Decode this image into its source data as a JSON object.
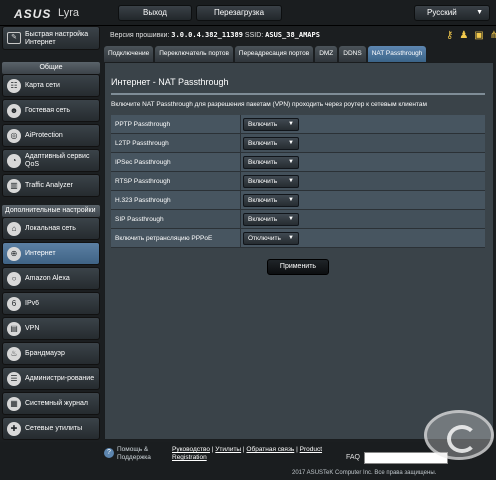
{
  "header": {
    "brand": "ASUS",
    "model": "Lyra",
    "logout_label": "Выход",
    "reboot_label": "Перезагрузка",
    "language": "Русский"
  },
  "info": {
    "fw_label": "Версия прошивки:",
    "fw_value": "3.0.0.4.382_11389",
    "ssid_label": "SSID:",
    "ssid_value": "ASUS_38_AMAPS"
  },
  "sidebar": {
    "quick_setup": "Быстрая настройка Интернет",
    "general_title": "Общие",
    "general_items": [
      {
        "label": "Карта сети",
        "icon": "network-map-icon"
      },
      {
        "label": "Гостевая сеть",
        "icon": "guest-network-icon"
      },
      {
        "label": "AiProtection",
        "icon": "aiprotection-icon"
      },
      {
        "label": "Адаптивный сервис QoS",
        "icon": "qos-icon"
      },
      {
        "label": "Traffic Analyzer",
        "icon": "traffic-analyzer-icon"
      }
    ],
    "advanced_title": "Дополнительные настройки",
    "advanced_items": [
      {
        "label": "Локальная сеть",
        "icon": "lan-icon"
      },
      {
        "label": "Интернет",
        "icon": "globe-icon",
        "active": true
      },
      {
        "label": "Amazon Alexa",
        "icon": "alexa-icon"
      },
      {
        "label": "IPv6",
        "icon": "ipv6-icon"
      },
      {
        "label": "VPN",
        "icon": "vpn-icon"
      },
      {
        "label": "Брандмауэр",
        "icon": "firewall-icon"
      },
      {
        "label": "Администри-рование",
        "icon": "administration-icon"
      },
      {
        "label": "Системный журнал",
        "icon": "system-log-icon"
      },
      {
        "label": "Сетевые утилиты",
        "icon": "network-tools-icon"
      }
    ]
  },
  "tabs": [
    {
      "label": "Подключение",
      "active": false
    },
    {
      "label": "Переключатель портов",
      "active": false
    },
    {
      "label": "Переадресация портов",
      "active": false
    },
    {
      "label": "DMZ",
      "active": false
    },
    {
      "label": "DDNS",
      "active": false
    },
    {
      "label": "NAT Passthrough",
      "active": true
    }
  ],
  "main": {
    "title": "Интернет - NAT Passthrough",
    "description": "Включите NAT Passthrough для разрешения пакетам (VPN) проходить через роутер к сетевым клиентам",
    "rows": [
      {
        "label": "PPTP Passthrough",
        "value": "Включить"
      },
      {
        "label": "L2TP Passthrough",
        "value": "Включить"
      },
      {
        "label": "IPSec Passthrough",
        "value": "Включить"
      },
      {
        "label": "RTSP Passthrough",
        "value": "Включить"
      },
      {
        "label": "H.323 Passthrough",
        "value": "Включить"
      },
      {
        "label": "SIP Passthrough",
        "value": "Включить"
      },
      {
        "label": "Включить ретрансляцию PPPoE",
        "value": "Отключить"
      }
    ],
    "apply_label": "Применить"
  },
  "footer": {
    "help_label": "Помощь & Поддержка",
    "links": [
      "Руководство",
      "Утилиты",
      "Обратная связь",
      "Product Registration"
    ],
    "faq_label": "FAQ",
    "copyright": "2017 ASUSTeK Computer Inc. Все права защищены."
  },
  "colors": {
    "background": "#1b1e20",
    "content_panel": "#3a4349",
    "active_tab": "#5d86b0",
    "active_sidebar": "#4f739a"
  }
}
